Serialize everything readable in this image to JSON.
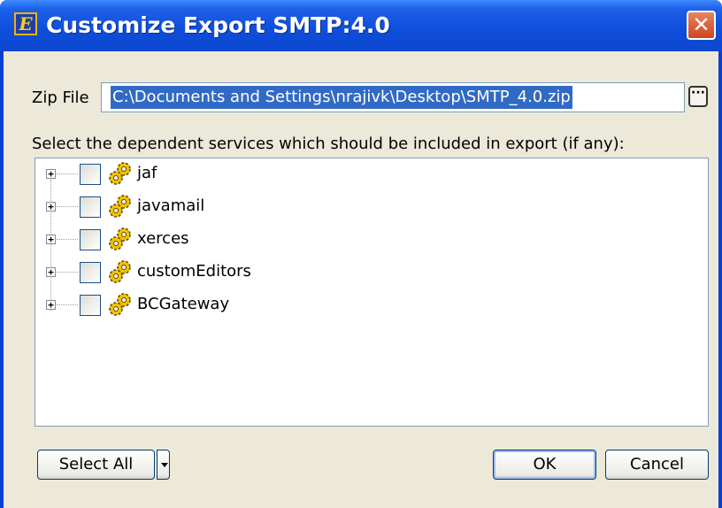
{
  "window": {
    "title": "Customize Export SMTP:4.0",
    "app_icon_letter": "E",
    "close_glyph": "✕"
  },
  "zip": {
    "label": "Zip File",
    "value": "C:\\Documents and Settings\\nrajivk\\Desktop\\SMTP_4.0.zip",
    "browse_label": "···"
  },
  "instructions": "Select the dependent services which should be included in export (if any):",
  "tree": {
    "expander_glyph": "+",
    "items": [
      {
        "label": "jaf",
        "checked": false,
        "icon": "gears-icon"
      },
      {
        "label": "javamail",
        "checked": false,
        "icon": "gears-icon"
      },
      {
        "label": "xerces",
        "checked": false,
        "icon": "gears-icon"
      },
      {
        "label": "customEditors",
        "checked": false,
        "icon": "gears-icon"
      },
      {
        "label": "BCGateway",
        "checked": false,
        "icon": "gears-icon"
      }
    ]
  },
  "buttons": {
    "select_all": "Select All",
    "ok": "OK",
    "cancel": "Cancel"
  },
  "colors": {
    "titlebar": "#0f4fdc",
    "selection": "#316ac5",
    "dialog_bg": "#ece9d8"
  }
}
